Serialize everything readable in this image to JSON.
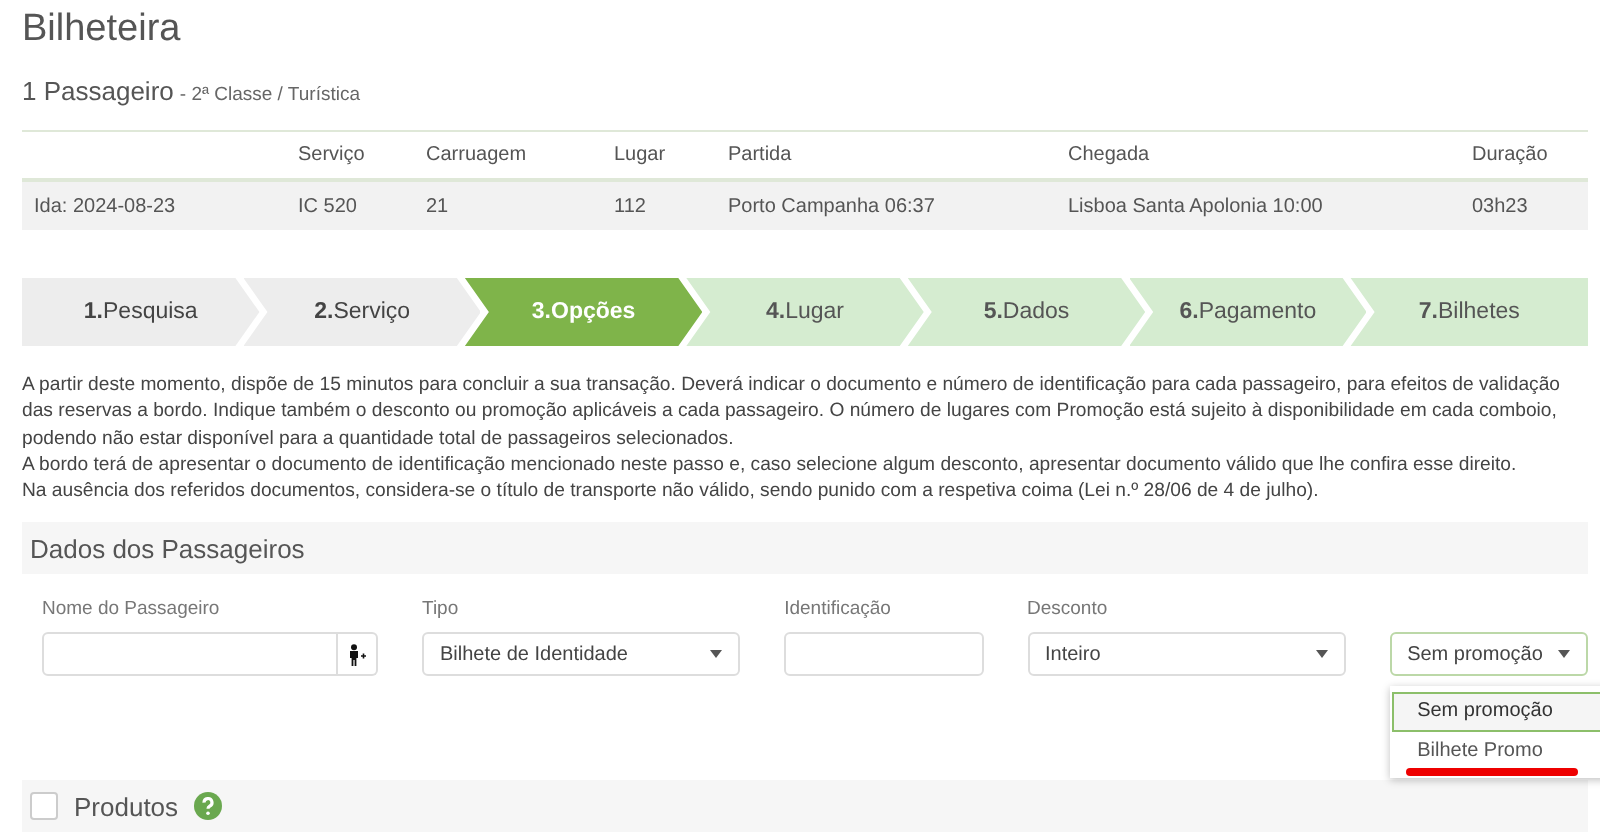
{
  "title": "Bilheteira",
  "subtitle": {
    "main": "1 Passageiro",
    "detail": "- 2ª Classe / Turística"
  },
  "trip_table": {
    "columns": [
      "",
      "Serviço",
      "Carruagem",
      "Lugar",
      "Partida",
      "Chegada",
      "Duração"
    ],
    "rows": [
      [
        "Ida: 2024-08-23",
        "IC 520",
        "21",
        "112",
        "Porto Campanha 06:37",
        "Lisboa Santa Apolonia 10:00",
        "03h23"
      ]
    ]
  },
  "steps": [
    {
      "label": "**1.**Pesquisa",
      "completed": true,
      "selected": false
    },
    {
      "label": "**2.**Serviço",
      "completed": true,
      "selected": false
    },
    {
      "label": "**3.Opções**",
      "completed": false,
      "selected": true
    },
    {
      "label": "**4.**Lugar",
      "completed": false,
      "selected": false
    },
    {
      "label": "**5.**Dados",
      "completed": false,
      "selected": false
    },
    {
      "label": "**6.**Pagamento",
      "completed": false,
      "selected": false
    },
    {
      "label": "**7.**Bilhetes",
      "completed": false,
      "selected": false
    }
  ],
  "notice": [
    "A partir deste momento, dispõe de 15 minutos para concluir a sua transação. Deverá indicar o documento e número de identificação para cada passageiro, para efeitos de validação das reservas a bordo. Indique também o desconto ou promoção aplicáveis a cada passageiro. O número de lugares com Promoção está sujeito à disponibilidade em cada comboio, podendo não estar disponível para a quantidade total de passageiros selecionados.",
    "A bordo terá de apresentar o documento de identificação mencionado neste passo e, caso selecione algum desconto, apresentar documento válido que lhe confira esse direito.",
    "Na ausência dos referidos documentos, considera-se o título de transporte não válido, sendo punido com a respetiva coima (Lei n.º 28/06 de 4 de julho)."
  ],
  "passenger_section": {
    "title": "Dados dos Passageiros",
    "fields": [
      {
        "kind": "name",
        "label": "Nome do Passageiro"
      },
      {
        "kind": "select",
        "label": "Tipo",
        "value": "Bilhete de Identidade"
      },
      {
        "kind": "text",
        "label": "Identificação"
      },
      {
        "kind": "select",
        "label": "Desconto",
        "value": "Inteiro"
      },
      {
        "kind": "dropdown",
        "value": "Sem promoção",
        "open": true,
        "options": [
          {
            "label": "Sem promoção",
            "selected": true,
            "underlined": false
          },
          {
            "label": "Bilhete Promo",
            "selected": false,
            "underlined": true
          }
        ]
      }
    ]
  },
  "products": {
    "label": "Produtos",
    "checked": false
  }
}
